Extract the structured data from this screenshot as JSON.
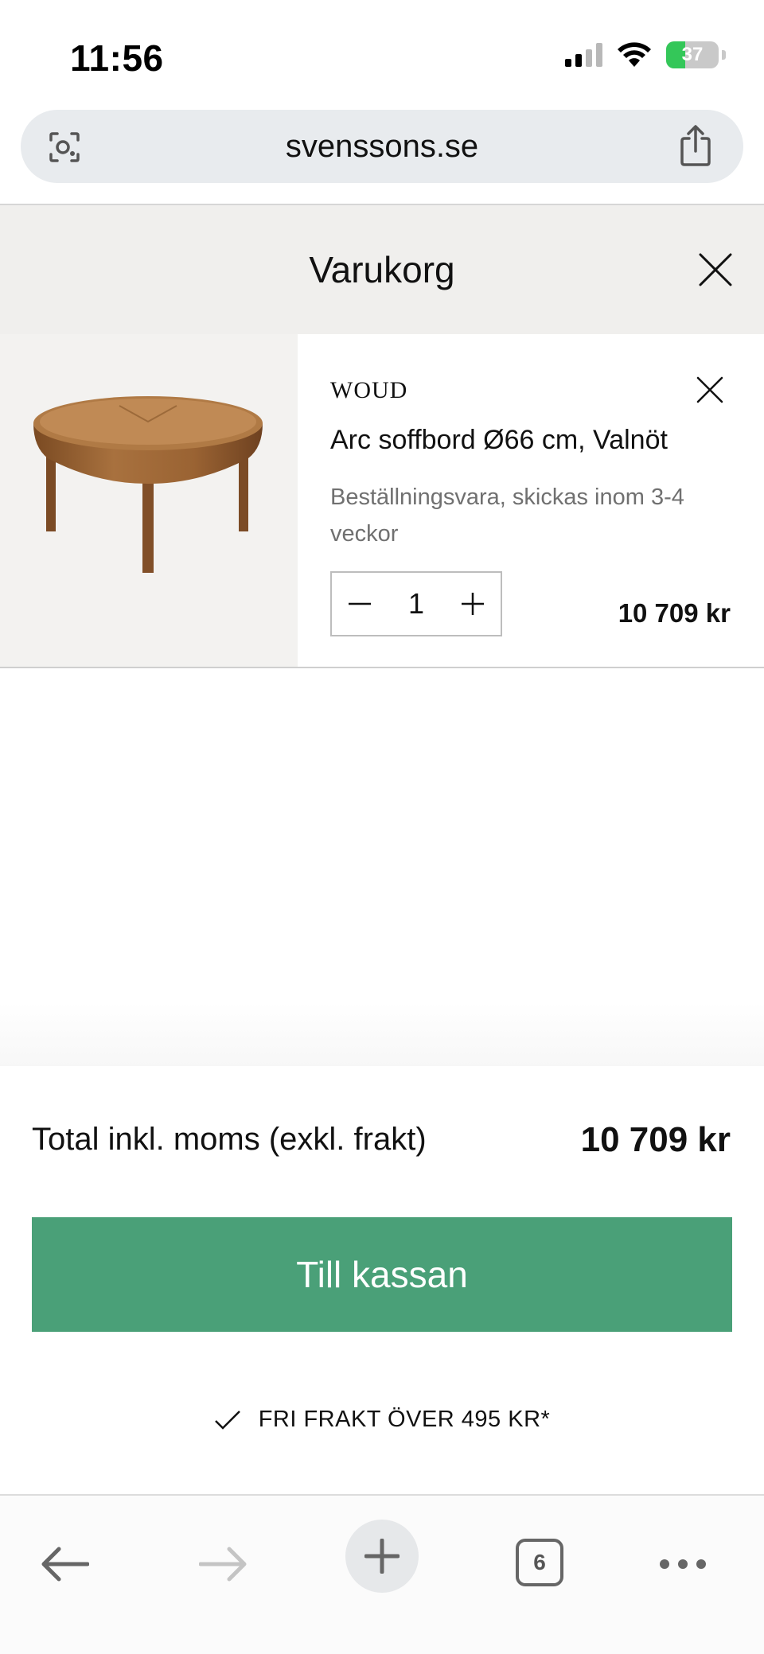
{
  "status_bar": {
    "time": "11:56",
    "battery": "37",
    "battery_level": 0.37
  },
  "browser": {
    "url": "svenssons.se",
    "tab_count": "6"
  },
  "cart": {
    "title": "Varukorg",
    "items": [
      {
        "brand": "WOUD",
        "name": "Arc soffbord Ø66 cm, Valnöt",
        "delivery": "Beställningsvara, skickas inom 3-4 veckor",
        "quantity": "1",
        "price": "10 709 kr"
      }
    ],
    "total_label": "Total inkl. moms (exkl. frakt)",
    "total_value": "10 709 kr",
    "checkout_label": "Till kassan",
    "free_shipping": "FRI FRAKT ÖVER 495 KR*"
  },
  "colors": {
    "accent": "#4aa078",
    "header_bg": "#f0efed",
    "battery_fill": "#34c759"
  }
}
